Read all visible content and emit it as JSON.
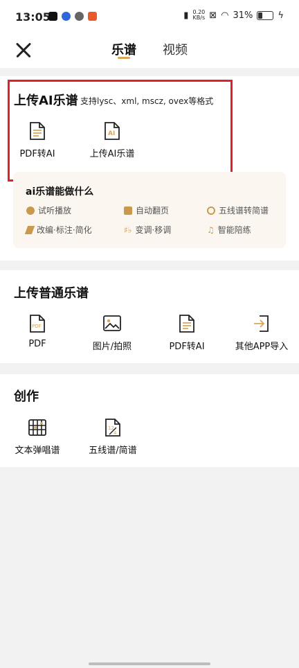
{
  "status_bar": {
    "time": "13:05",
    "net_speed_value": "0.20",
    "net_speed_unit": "KB/s",
    "battery": "31%"
  },
  "header": {
    "tabs": [
      "乐谱",
      "视频"
    ],
    "active_tab": "乐谱",
    "accent_color": "#d9a559"
  },
  "ai_upload": {
    "title": "上传AI乐谱",
    "subtitle": "支持lysc、xml, mscz, ovex等格式",
    "items": [
      "PDF转AI",
      "上传AI乐谱"
    ],
    "highlight_color": "#e0202a"
  },
  "ai_info": {
    "title": "ai乐谱能做什么",
    "features": [
      "试听播放",
      "自动翻页",
      "五线谱转简谱",
      "改编·标注·简化",
      "变调·移调",
      "智能陪练"
    ]
  },
  "normal_upload": {
    "title": "上传普通乐谱",
    "items": [
      "PDF",
      "图片/拍照",
      "PDF转AI",
      "其他APP导入"
    ]
  },
  "create": {
    "title": "创作",
    "items": [
      "文本弹唱谱",
      "五线谱/简谱"
    ]
  }
}
